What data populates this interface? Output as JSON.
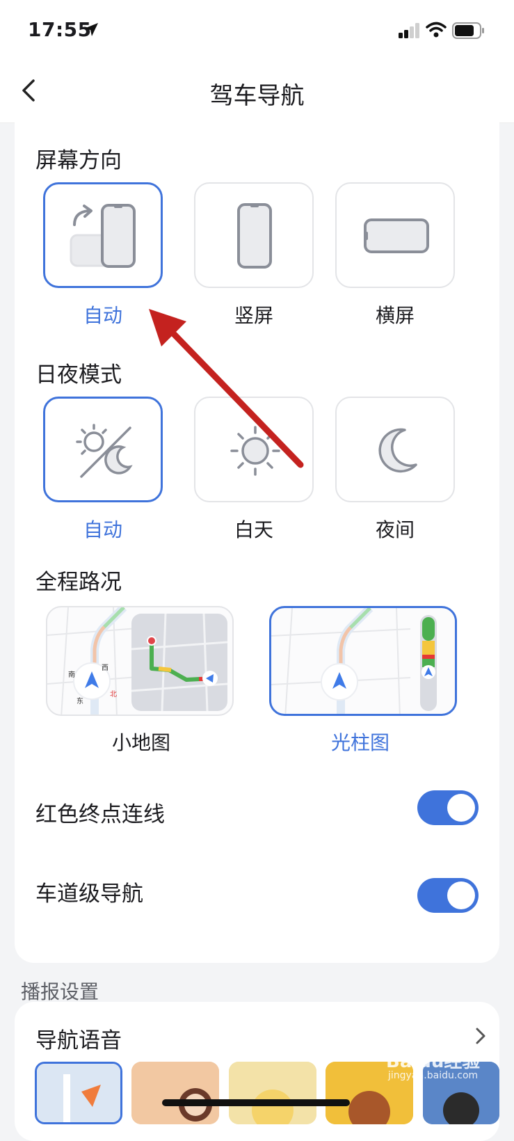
{
  "status": {
    "time": "17:55"
  },
  "header": {
    "title": "驾车导航"
  },
  "screen_orientation": {
    "title": "屏幕方向",
    "options": [
      {
        "label": "自动",
        "icon": "auto-rotate-icon",
        "selected": true
      },
      {
        "label": "竖屏",
        "icon": "portrait-phone-icon",
        "selected": false
      },
      {
        "label": "横屏",
        "icon": "landscape-phone-icon",
        "selected": false
      }
    ]
  },
  "day_night": {
    "title": "日夜模式",
    "options": [
      {
        "label": "自动",
        "icon": "sun-moon-icon",
        "selected": true
      },
      {
        "label": "白天",
        "icon": "sun-icon",
        "selected": false
      },
      {
        "label": "夜间",
        "icon": "moon-icon",
        "selected": false
      }
    ]
  },
  "traffic": {
    "title": "全程路况",
    "options": [
      {
        "label": "小地图",
        "selected": false
      },
      {
        "label": "光柱图",
        "selected": true
      }
    ],
    "compass": {
      "north": "北",
      "south": "南",
      "east": "东",
      "west": "西"
    }
  },
  "toggles": [
    {
      "label": "红色终点连线",
      "on": true
    },
    {
      "label": "车道级导航",
      "on": true
    }
  ],
  "broadcast": {
    "group_title": "播报设置",
    "voice_title": "导航语音"
  },
  "watermark": {
    "brand": "Baidu经验",
    "url": "jingyan.baidu.com"
  },
  "colors": {
    "accent": "#3f73db",
    "annotation_arrow": "#c4221f"
  }
}
